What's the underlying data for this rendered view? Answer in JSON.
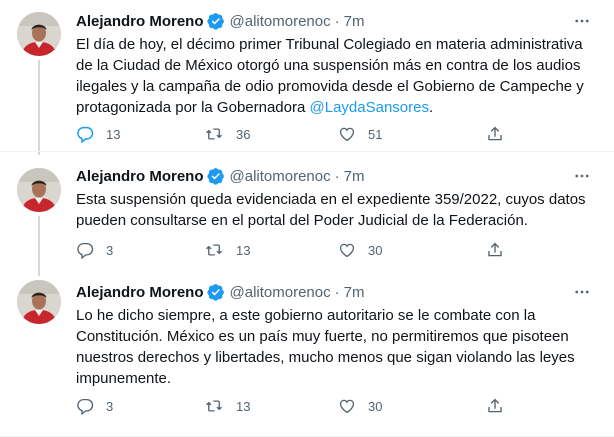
{
  "colors": {
    "accent": "#1d9bf0",
    "muted": "#536471",
    "text": "#0f1419",
    "divider": "#eff3f4"
  },
  "tweets": [
    {
      "author_name": "Alejandro Moreno",
      "handle": "@alitomorenoc",
      "separator": "·",
      "time": "7m",
      "text_before": "El día de hoy, el décimo primer Tribunal Colegiado en materia administrativa de la Ciudad de México otorgó una suspensión más en contra de los audios ilegales y la campaña de odio promovida desde el Gobierno de Campeche y protagonizada por la Gobernadora ",
      "mention": "@LaydaSansores",
      "text_after": ".",
      "replies": "13",
      "retweets": "36",
      "likes": "51",
      "icons": [
        "verified-badge-icon",
        "more-icon",
        "reply-icon",
        "retweet-icon",
        "like-icon",
        "share-icon"
      ]
    },
    {
      "author_name": "Alejandro Moreno",
      "handle": "@alitomorenoc",
      "separator": "·",
      "time": "7m",
      "text": "Esta suspensión queda evidenciada en el expediente 359/2022, cuyos datos pueden consultarse en el portal del Poder Judicial de la Federación.",
      "replies": "3",
      "retweets": "13",
      "likes": "30",
      "icons": [
        "verified-badge-icon",
        "more-icon",
        "reply-icon",
        "retweet-icon",
        "like-icon",
        "share-icon"
      ]
    },
    {
      "author_name": "Alejandro Moreno",
      "handle": "@alitomorenoc",
      "separator": "·",
      "time": "7m",
      "text": "Lo he dicho siempre, a este gobierno autoritario se le combate con la Constitución. México es un país muy fuerte, no permitiremos que pisoteen nuestros derechos y libertades, mucho menos que sigan violando las leyes impunemente.",
      "replies": "3",
      "retweets": "13",
      "likes": "30",
      "icons": [
        "verified-badge-icon",
        "more-icon",
        "reply-icon",
        "retweet-icon",
        "like-icon",
        "share-icon"
      ]
    }
  ]
}
